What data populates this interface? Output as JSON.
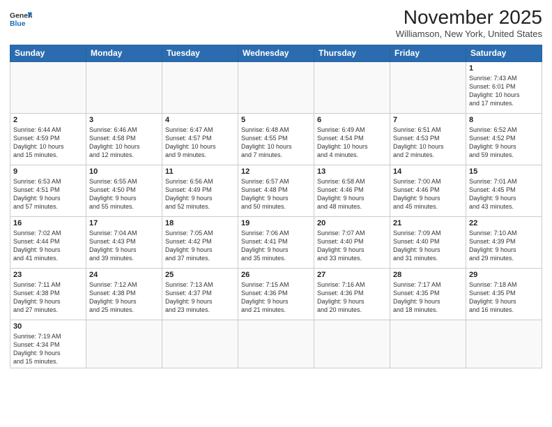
{
  "header": {
    "logo_general": "General",
    "logo_blue": "Blue",
    "month": "November 2025",
    "location": "Williamson, New York, United States"
  },
  "days_of_week": [
    "Sunday",
    "Monday",
    "Tuesday",
    "Wednesday",
    "Thursday",
    "Friday",
    "Saturday"
  ],
  "weeks": [
    [
      {
        "day": "",
        "info": ""
      },
      {
        "day": "",
        "info": ""
      },
      {
        "day": "",
        "info": ""
      },
      {
        "day": "",
        "info": ""
      },
      {
        "day": "",
        "info": ""
      },
      {
        "day": "",
        "info": ""
      },
      {
        "day": "1",
        "info": "Sunrise: 7:43 AM\nSunset: 6:01 PM\nDaylight: 10 hours\nand 17 minutes."
      }
    ],
    [
      {
        "day": "2",
        "info": "Sunrise: 6:44 AM\nSunset: 4:59 PM\nDaylight: 10 hours\nand 15 minutes."
      },
      {
        "day": "3",
        "info": "Sunrise: 6:46 AM\nSunset: 4:58 PM\nDaylight: 10 hours\nand 12 minutes."
      },
      {
        "day": "4",
        "info": "Sunrise: 6:47 AM\nSunset: 4:57 PM\nDaylight: 10 hours\nand 9 minutes."
      },
      {
        "day": "5",
        "info": "Sunrise: 6:48 AM\nSunset: 4:55 PM\nDaylight: 10 hours\nand 7 minutes."
      },
      {
        "day": "6",
        "info": "Sunrise: 6:49 AM\nSunset: 4:54 PM\nDaylight: 10 hours\nand 4 minutes."
      },
      {
        "day": "7",
        "info": "Sunrise: 6:51 AM\nSunset: 4:53 PM\nDaylight: 10 hours\nand 2 minutes."
      },
      {
        "day": "8",
        "info": "Sunrise: 6:52 AM\nSunset: 4:52 PM\nDaylight: 9 hours\nand 59 minutes."
      }
    ],
    [
      {
        "day": "9",
        "info": "Sunrise: 6:53 AM\nSunset: 4:51 PM\nDaylight: 9 hours\nand 57 minutes."
      },
      {
        "day": "10",
        "info": "Sunrise: 6:55 AM\nSunset: 4:50 PM\nDaylight: 9 hours\nand 55 minutes."
      },
      {
        "day": "11",
        "info": "Sunrise: 6:56 AM\nSunset: 4:49 PM\nDaylight: 9 hours\nand 52 minutes."
      },
      {
        "day": "12",
        "info": "Sunrise: 6:57 AM\nSunset: 4:48 PM\nDaylight: 9 hours\nand 50 minutes."
      },
      {
        "day": "13",
        "info": "Sunrise: 6:58 AM\nSunset: 4:46 PM\nDaylight: 9 hours\nand 48 minutes."
      },
      {
        "day": "14",
        "info": "Sunrise: 7:00 AM\nSunset: 4:46 PM\nDaylight: 9 hours\nand 45 minutes."
      },
      {
        "day": "15",
        "info": "Sunrise: 7:01 AM\nSunset: 4:45 PM\nDaylight: 9 hours\nand 43 minutes."
      }
    ],
    [
      {
        "day": "16",
        "info": "Sunrise: 7:02 AM\nSunset: 4:44 PM\nDaylight: 9 hours\nand 41 minutes."
      },
      {
        "day": "17",
        "info": "Sunrise: 7:04 AM\nSunset: 4:43 PM\nDaylight: 9 hours\nand 39 minutes."
      },
      {
        "day": "18",
        "info": "Sunrise: 7:05 AM\nSunset: 4:42 PM\nDaylight: 9 hours\nand 37 minutes."
      },
      {
        "day": "19",
        "info": "Sunrise: 7:06 AM\nSunset: 4:41 PM\nDaylight: 9 hours\nand 35 minutes."
      },
      {
        "day": "20",
        "info": "Sunrise: 7:07 AM\nSunset: 4:40 PM\nDaylight: 9 hours\nand 33 minutes."
      },
      {
        "day": "21",
        "info": "Sunrise: 7:09 AM\nSunset: 4:40 PM\nDaylight: 9 hours\nand 31 minutes."
      },
      {
        "day": "22",
        "info": "Sunrise: 7:10 AM\nSunset: 4:39 PM\nDaylight: 9 hours\nand 29 minutes."
      }
    ],
    [
      {
        "day": "23",
        "info": "Sunrise: 7:11 AM\nSunset: 4:38 PM\nDaylight: 9 hours\nand 27 minutes."
      },
      {
        "day": "24",
        "info": "Sunrise: 7:12 AM\nSunset: 4:38 PM\nDaylight: 9 hours\nand 25 minutes."
      },
      {
        "day": "25",
        "info": "Sunrise: 7:13 AM\nSunset: 4:37 PM\nDaylight: 9 hours\nand 23 minutes."
      },
      {
        "day": "26",
        "info": "Sunrise: 7:15 AM\nSunset: 4:36 PM\nDaylight: 9 hours\nand 21 minutes."
      },
      {
        "day": "27",
        "info": "Sunrise: 7:16 AM\nSunset: 4:36 PM\nDaylight: 9 hours\nand 20 minutes."
      },
      {
        "day": "28",
        "info": "Sunrise: 7:17 AM\nSunset: 4:35 PM\nDaylight: 9 hours\nand 18 minutes."
      },
      {
        "day": "29",
        "info": "Sunrise: 7:18 AM\nSunset: 4:35 PM\nDaylight: 9 hours\nand 16 minutes."
      }
    ],
    [
      {
        "day": "30",
        "info": "Sunrise: 7:19 AM\nSunset: 4:34 PM\nDaylight: 9 hours\nand 15 minutes."
      },
      {
        "day": "",
        "info": ""
      },
      {
        "day": "",
        "info": ""
      },
      {
        "day": "",
        "info": ""
      },
      {
        "day": "",
        "info": ""
      },
      {
        "day": "",
        "info": ""
      },
      {
        "day": "",
        "info": ""
      }
    ]
  ]
}
